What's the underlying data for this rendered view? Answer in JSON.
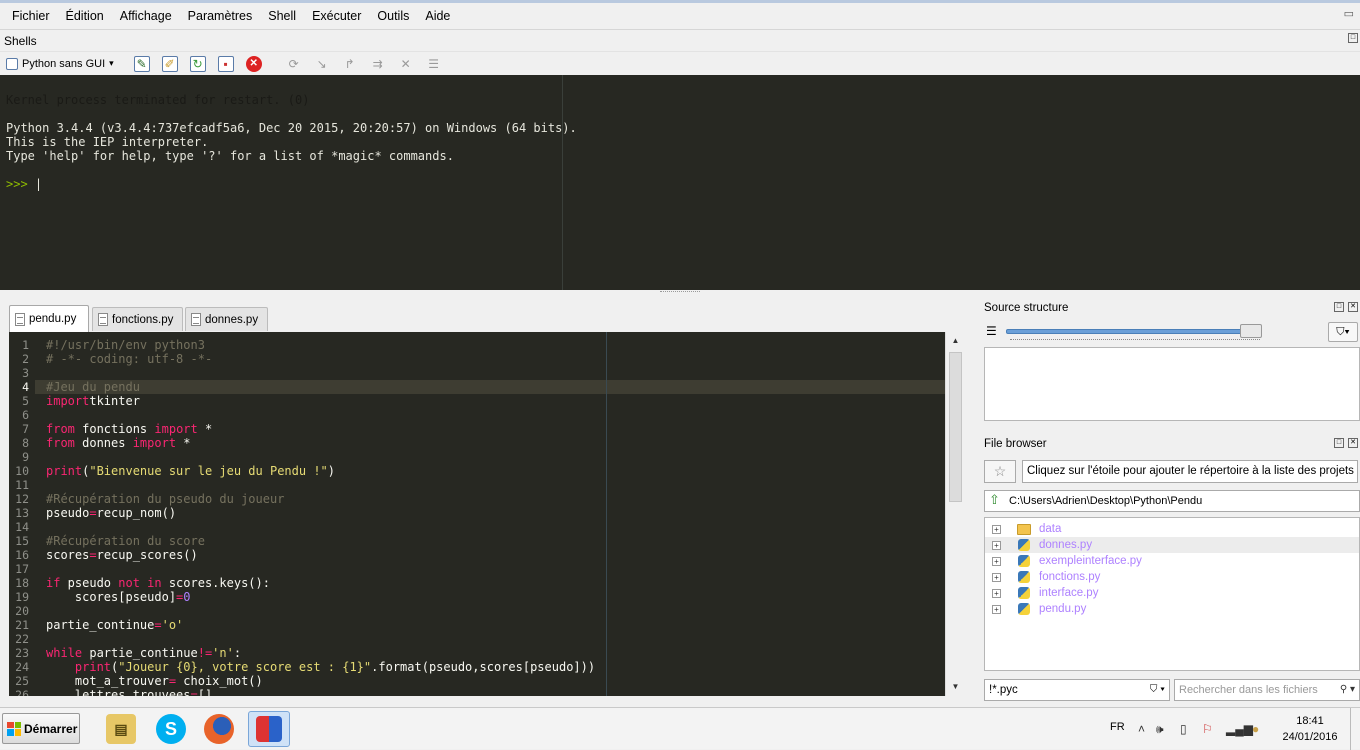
{
  "menu": [
    "Fichier",
    "Édition",
    "Affichage",
    "Paramètres",
    "Shell",
    "Exécuter",
    "Outils",
    "Aide"
  ],
  "shells": {
    "title": "Shells",
    "selector": "Python sans GUI",
    "output": [
      {
        "text": "Kernel process terminated for restart. (0)",
        "style": "dim"
      },
      {
        "text": "",
        "style": "l"
      },
      {
        "text": "Python 3.4.4 (v3.4.4:737efcadf5a6, Dec 20 2015, 20:20:57) on Windows (64 bits).",
        "style": "l"
      },
      {
        "text": "This is the IEP interpreter.",
        "style": "l"
      },
      {
        "text": "Type 'help' for help, type '?' for a list of *magic* commands.",
        "style": "l"
      },
      {
        "text": "",
        "style": "l"
      }
    ],
    "prompt": ">>> "
  },
  "tabs": [
    {
      "label": "pendu.py",
      "active": true
    },
    {
      "label": "fonctions.py",
      "active": false
    },
    {
      "label": "donnes.py",
      "active": false
    }
  ],
  "editor": {
    "current_line": 4,
    "lines": [
      [
        [
          "cm",
          "#!/usr/bin/env python3"
        ]
      ],
      [
        [
          "cm",
          "# -*- coding: utf-8 -*-"
        ]
      ],
      [],
      [
        [
          "cm",
          "#Jeu du pendu"
        ]
      ],
      [
        [
          "kw",
          "import"
        ],
        [
          "",
          "tkinter"
        ]
      ],
      [],
      [
        [
          "kw",
          "from"
        ],
        [
          "",
          " fonctions "
        ],
        [
          "kw",
          "import"
        ],
        [
          "",
          " *"
        ]
      ],
      [
        [
          "kw",
          "from"
        ],
        [
          "",
          " donnes "
        ],
        [
          "kw",
          "import"
        ],
        [
          "",
          " *"
        ]
      ],
      [],
      [
        [
          "kw",
          "print"
        ],
        [
          "",
          "("
        ],
        [
          "st",
          "\"Bienvenue sur le jeu du Pendu !\""
        ],
        [
          "",
          ")"
        ]
      ],
      [],
      [
        [
          "cm",
          "#Récupération du pseudo du joueur"
        ]
      ],
      [
        [
          "",
          "pseudo"
        ],
        [
          "kw",
          "="
        ],
        [
          "",
          "recup_nom()"
        ]
      ],
      [],
      [
        [
          "cm",
          "#Récupération du score"
        ]
      ],
      [
        [
          "",
          "scores"
        ],
        [
          "kw",
          "="
        ],
        [
          "",
          "recup_scores()"
        ]
      ],
      [],
      [
        [
          "kw",
          "if"
        ],
        [
          "",
          " pseudo "
        ],
        [
          "kw",
          "not in"
        ],
        [
          "",
          " scores.keys():"
        ]
      ],
      [
        [
          "",
          "    scores[pseudo]"
        ],
        [
          "kw",
          "="
        ],
        [
          "nm",
          "0"
        ]
      ],
      [],
      [
        [
          "",
          "partie_continue"
        ],
        [
          "kw",
          "="
        ],
        [
          "st",
          "'o'"
        ]
      ],
      [],
      [
        [
          "kw",
          "while"
        ],
        [
          "",
          " partie_continue"
        ],
        [
          "kw",
          "!="
        ],
        [
          "st",
          "'n'"
        ],
        [
          "",
          ":"
        ]
      ],
      [
        [
          "kw",
          "    print"
        ],
        [
          "",
          "("
        ],
        [
          "st",
          "\"Joueur {0}, votre score est : {1}\""
        ],
        [
          "",
          ".format(pseudo,scores[pseudo]))"
        ]
      ],
      [
        [
          "",
          "    mot_a_trouver"
        ],
        [
          "kw",
          "="
        ],
        [
          "",
          " choix_mot()"
        ]
      ],
      [
        [
          "",
          "    lettres_trouvees"
        ],
        [
          "kw",
          "="
        ],
        [
          "",
          "[]"
        ]
      ]
    ]
  },
  "source_structure": {
    "title": "Source structure"
  },
  "file_browser": {
    "title": "File browser",
    "fav_hint": "Cliquez sur l'étoile pour ajouter le répertoire à la liste des projets",
    "path": "C:\\Users\\Adrien\\Desktop\\Python\\Pendu",
    "items": [
      {
        "name": "data",
        "type": "folder"
      },
      {
        "name": "donnes.py",
        "type": "py"
      },
      {
        "name": "exempleinterface.py",
        "type": "py"
      },
      {
        "name": "fonctions.py",
        "type": "py"
      },
      {
        "name": "interface.py",
        "type": "py"
      },
      {
        "name": "pendu.py",
        "type": "py"
      }
    ],
    "filter": "!*.pyc",
    "search_placeholder": "Rechercher dans les fichiers"
  },
  "taskbar": {
    "start_label": "Démarrer",
    "lang": "FR",
    "time": "18:41",
    "date": "24/01/2016"
  },
  "colors": {
    "editor_bg": "#272822",
    "keyword": "#f92672",
    "string": "#e6db74",
    "comment": "#75715e",
    "number": "#ae81ff"
  }
}
